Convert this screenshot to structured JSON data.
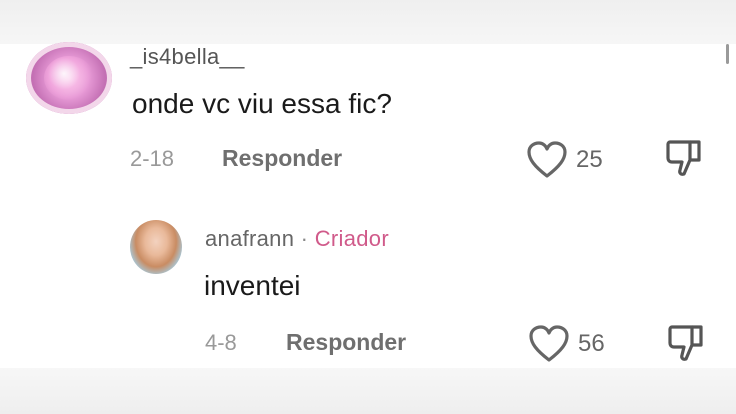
{
  "comments": [
    {
      "username": "_is4bella__",
      "text": "onde vc viu essa fic?",
      "date": "2-18",
      "reply_label": "Responder",
      "likes": "25",
      "avatar_icon": "pink-glitter-avatar"
    },
    {
      "username": "anafrann",
      "separator": " · ",
      "badge": "Criador",
      "text": "inventei",
      "date": "4-8",
      "reply_label": "Responder",
      "likes": "56",
      "avatar_icon": "profile-photo-avatar"
    }
  ],
  "icons": {
    "like": "heart-icon",
    "dislike": "thumbs-down-icon"
  },
  "colors": {
    "creator_badge": "#d05a8a",
    "secondary_text": "#999999",
    "primary_text": "#1a1a1a"
  }
}
